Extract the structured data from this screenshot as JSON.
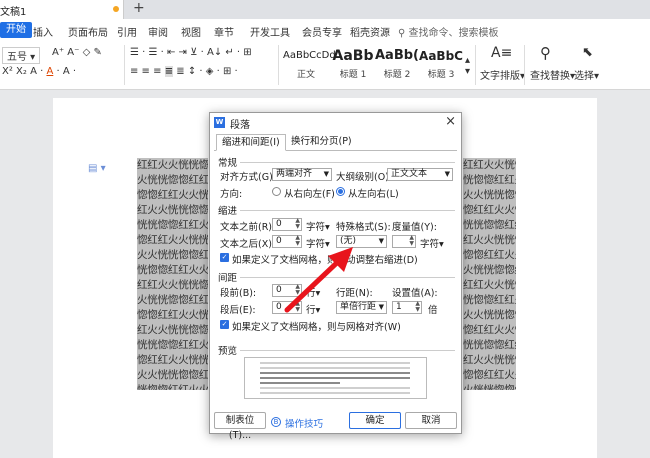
{
  "window": {
    "doc_tab_title": "文稿1",
    "new_tab_label": "+"
  },
  "menu": {
    "items": [
      "开始",
      "插入",
      "页面布局",
      "引用",
      "审阅",
      "视图",
      "章节",
      "开发工具",
      "会员专享",
      "稻壳资源"
    ],
    "search_placeholder": "查找命令、搜索模板"
  },
  "ribbon": {
    "font_size": "五号",
    "styles": [
      {
        "sample": "AaBbCcDd",
        "caption": "正文"
      },
      {
        "sample": "AaBb",
        "caption": "标题 1"
      },
      {
        "sample": "AaBb(",
        "caption": "标题 2"
      },
      {
        "sample": "AaBbC",
        "caption": "标题 3"
      }
    ],
    "text_layout_label": "文字排版",
    "find_replace_label": "查找替换",
    "select_label": "选择"
  },
  "document": {
    "repeat_text": "红红火火恍恍惚惚红红火火恍恍惚惚红红火火恍恍惚惚红红火火恍恍惚惚"
  },
  "dialog": {
    "title": "段落",
    "close_glyph": "×",
    "tabs": [
      "缩进和间距(I)",
      "换行和分页(P)"
    ],
    "general": {
      "heading": "常规",
      "alignment_label": "对齐方式(G):",
      "alignment_value": "两端对齐",
      "outline_label": "大纲级别(O):",
      "outline_value": "正文文本",
      "direction_label": "方向:",
      "rtl_label": "从右向左(F)",
      "ltr_label": "从左向右(L)"
    },
    "indent": {
      "heading": "缩进",
      "before_label": "文本之前(R):",
      "before_value": "0",
      "before_unit": "字符",
      "special_label": "特殊格式(S):",
      "measure_label": "度量值(Y):",
      "after_label": "文本之后(X):",
      "after_value": "0",
      "after_unit": "字符",
      "special_value": "(无)",
      "measure_unit": "字符",
      "grid_check_label": "如果定义了文档网格，则自动调整右缩进(D)"
    },
    "spacing": {
      "heading": "间距",
      "before_label": "段前(B):",
      "before_value": "0",
      "before_unit": "行",
      "line_label": "行距(N):",
      "setting_label": "设置值(A):",
      "after_label": "段后(E):",
      "after_value": "0",
      "after_unit": "行",
      "line_value": "单倍行距",
      "setting_value": "1",
      "setting_unit": "倍",
      "grid_check_label": "如果定义了文档网格，则与网格对齐(W)"
    },
    "preview_heading": "预览",
    "tabs_button": "制表位(T)...",
    "tips_label": "操作技巧",
    "ok_button": "确定",
    "cancel_button": "取消"
  },
  "colors": {
    "accent": "#2b6fe0",
    "highlight_gray": "#bfbfbf",
    "arrow_red": "#e8141c"
  }
}
